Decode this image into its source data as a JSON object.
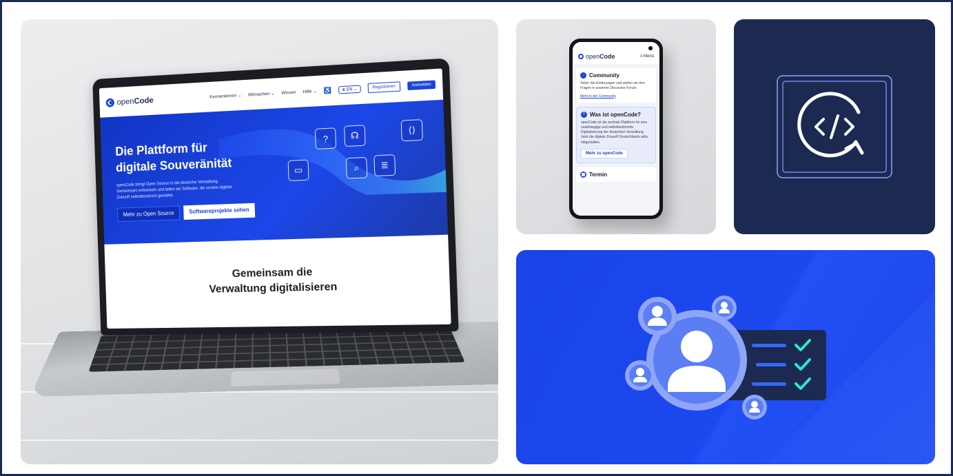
{
  "laptop": {
    "site": {
      "brand_prefix": "open",
      "brand_bold": "Code",
      "nav": [
        "Kennenlernen ⌄",
        "Mitmachen ⌄",
        "Wissen",
        "Hilfe ⌄"
      ],
      "lang": "EN ⌄",
      "register": "Registrieren",
      "login": "Anmelden",
      "hero_title_1": "Die Plattform für",
      "hero_title_2": "digitale Souveränität",
      "hero_text": "openCode bringt Open Source in die deutsche Verwaltung. Gemeinsam entwickeln und teilen wir Software, die unsere digitale Zukunft selbstbestimmt gestaltet.",
      "hero_btn_primary": "Mehr zu Open Source",
      "hero_btn_secondary": "Softwareprojekte sehen",
      "section_title_1": "Gemeinsam die",
      "section_title_2": "Verwaltung digitalisieren"
    }
  },
  "phone": {
    "brand_prefix": "open",
    "brand_bold": "Code",
    "menu": "≡ Menü",
    "community_title": "Community",
    "community_text": "Teilen Sie Erfahrungen und stellen sie ihre Fragen in unserem Discourse Forum.",
    "community_link": "Mehr in der Community",
    "about_title": "Was ist openCode?",
    "about_text": "openCode ist die zentrale Plattform für eine unabhängige und selbstbestimmte Digitalisierung der deutschen Verwaltung. Jetzt die digitale Zukunft Deutschlands aktiv mitgestalten.",
    "about_btn": "Mehr zu openCode",
    "event_title": "Termin"
  },
  "colors": {
    "navy": "#1c2a52",
    "brand_blue": "#1a44d8",
    "accent_teal": "#2ee6c8"
  },
  "icons": [
    "question-icon",
    "headset-icon",
    "gitlab-icon",
    "chat-icon",
    "code-search-icon",
    "document-icon",
    "code-refresh-icon",
    "user-icon",
    "check-icon"
  ]
}
